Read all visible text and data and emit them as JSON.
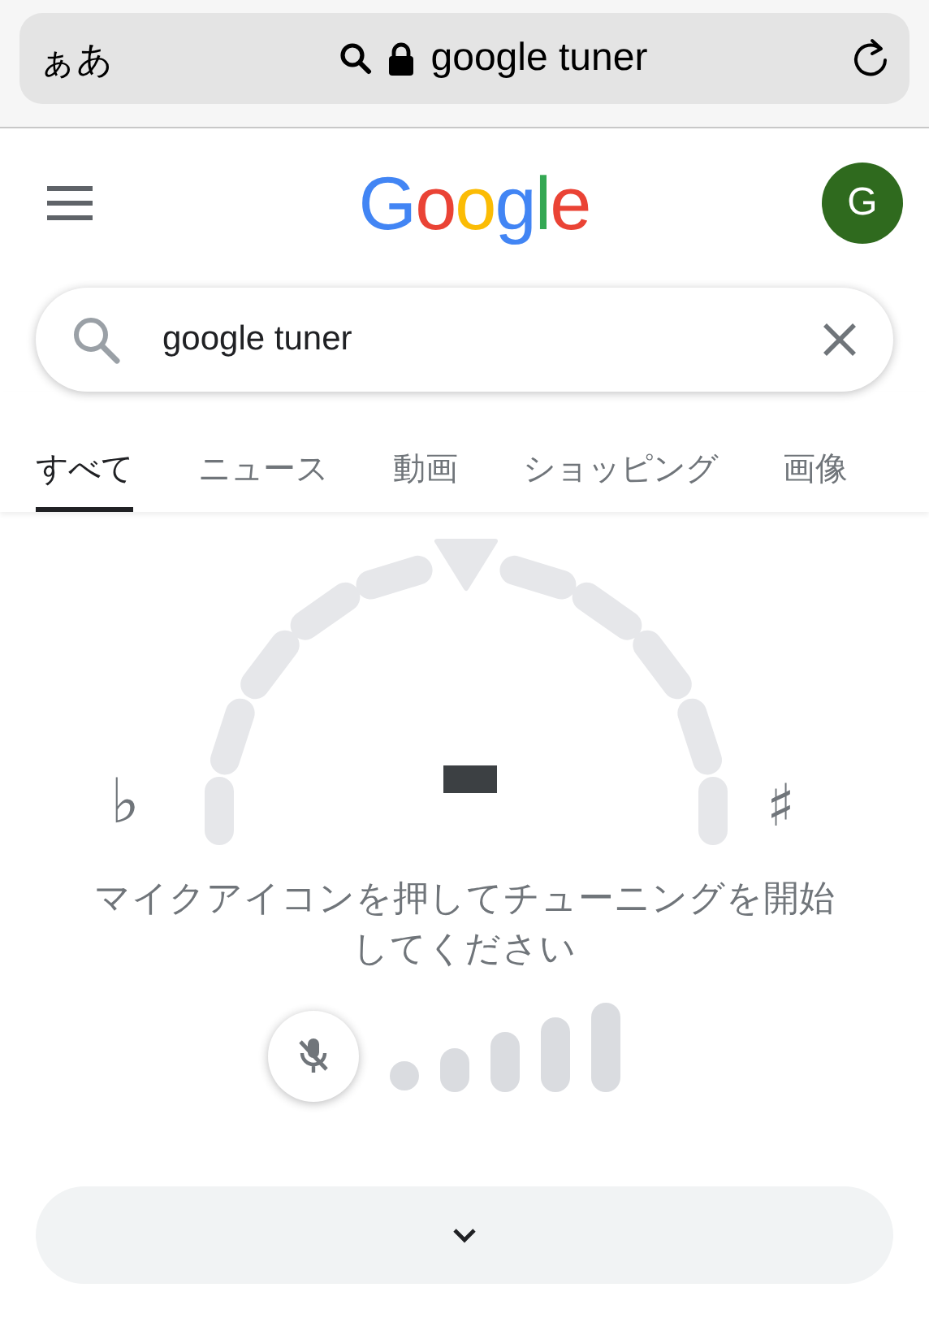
{
  "address_bar": {
    "text_size_button": "ぁあ",
    "url": "google tuner"
  },
  "header": {
    "logo": "Google",
    "avatar": "G"
  },
  "search": {
    "value": "google tuner"
  },
  "tabs": [
    {
      "label": "すべて",
      "selected": true
    },
    {
      "label": "ニュース",
      "selected": false
    },
    {
      "label": "動画",
      "selected": false
    },
    {
      "label": "ショッピング",
      "selected": false
    },
    {
      "label": "画像",
      "selected": false
    }
  ],
  "tuner": {
    "flat": "♭",
    "sharp": "♯",
    "instruction": "マイクアイコンを押してチューニングを開始してください",
    "mic_muted": true
  }
}
